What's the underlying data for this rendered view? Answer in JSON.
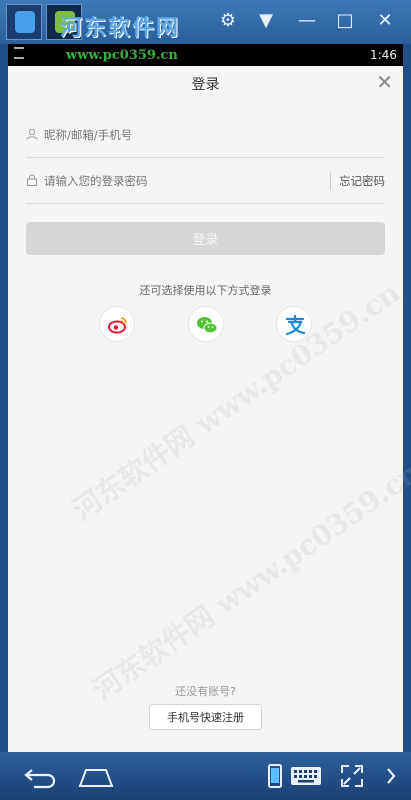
{
  "window": {
    "brand_text": "河东软件网",
    "brand_url": "www.pc0359.cn"
  },
  "statusbar": {
    "time": "1:46"
  },
  "login": {
    "title": "登录",
    "username_placeholder": "昵称/邮箱/手机号",
    "password_placeholder": "请输入您的登录密码",
    "forgot_label": "忘记密码",
    "login_label": "登录",
    "alt_text": "还可选择使用以下方式登录",
    "social": [
      {
        "name": "weibo-icon",
        "color": "#e6162d"
      },
      {
        "name": "wechat-icon",
        "color": "#51c332"
      },
      {
        "name": "alipay-icon",
        "color": "#1b8bd8"
      }
    ],
    "no_account_text": "还没有账号?",
    "register_label": "手机号快速注册"
  },
  "watermark": "河东软件网 www.pc0359.cn"
}
